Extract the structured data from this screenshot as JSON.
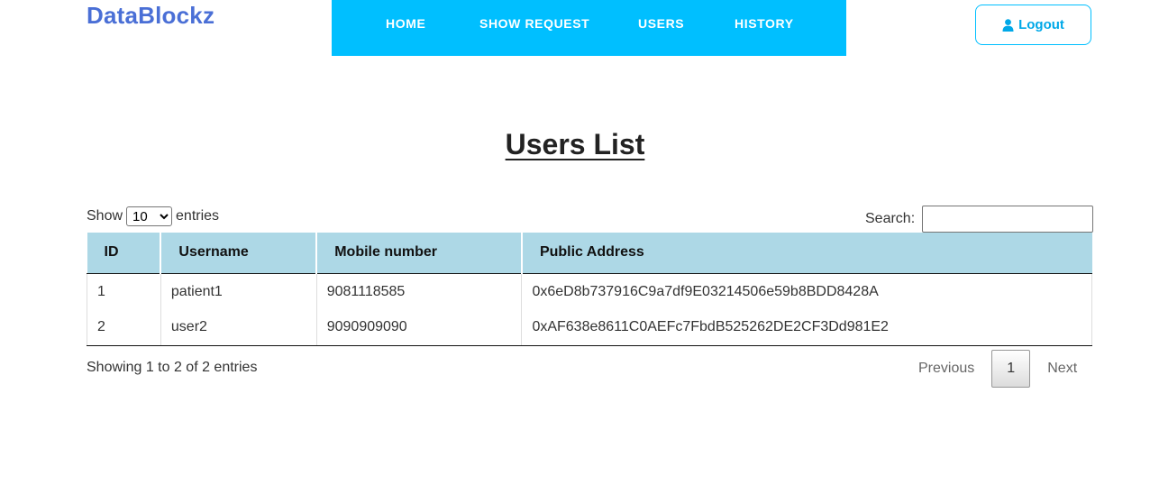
{
  "brand": "DataBlockz",
  "nav": {
    "items": [
      {
        "label": "HOME"
      },
      {
        "label": "SHOW REQUEST"
      },
      {
        "label": "USERS"
      },
      {
        "label": "HISTORY"
      }
    ],
    "background": "#00bfff"
  },
  "logout": {
    "label": "Logout",
    "icon": "user-icon"
  },
  "page_title": "Users List",
  "length_control": {
    "prefix": "Show",
    "selected": "10",
    "suffix": "entries"
  },
  "search": {
    "label": "Search:",
    "value": ""
  },
  "table": {
    "headers": [
      "ID",
      "Username",
      "Mobile number",
      "Public Address"
    ],
    "rows": [
      [
        "1",
        "patient1",
        "9081118585",
        "0x6eD8b737916C9a7df9E03214506e59b8BDD8428A"
      ],
      [
        "2",
        "user2",
        "9090909090",
        "0xAF638e8611C0AEFc7FbdB525262DE2CF3Dd981E2"
      ]
    ],
    "header_color": "#add8e6"
  },
  "info": "Showing 1 to 2 of 2 entries",
  "pagination": {
    "previous": "Previous",
    "current": "1",
    "next": "Next"
  }
}
